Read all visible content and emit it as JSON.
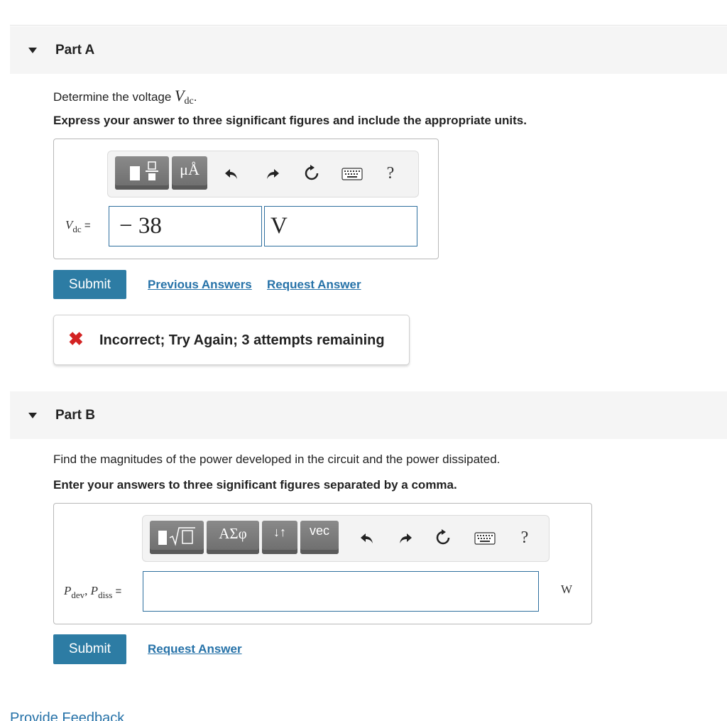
{
  "partA": {
    "title": "Part A",
    "prompt_text": "Determine the voltage ",
    "prompt_var": "V",
    "prompt_sub": "dc",
    "prompt_end": ".",
    "instruction": "Express your answer to three significant figures and include the appropriate units.",
    "toolbar": {
      "units_button_label": "μÅ",
      "help_label": "?"
    },
    "label_var": "V",
    "label_sub": "dc",
    "label_eq": " =",
    "value": "− 38",
    "unit": "V",
    "submit_label": "Submit",
    "previous_answers_label": "Previous Answers",
    "request_answer_label": "Request Answer",
    "feedback": {
      "icon": "x-icon",
      "message": "Incorrect; Try Again; 3 attempts remaining",
      "color": "#d32323"
    }
  },
  "partB": {
    "title": "Part B",
    "prompt": "Find the magnitudes of the power developed in the circuit and the power dissipated.",
    "instruction": "Enter your answers to three significant figures separated by a comma.",
    "toolbar": {
      "greek_button_label": "ΑΣφ",
      "arrows_button_label": "↓↑",
      "vec_button_label": "vec",
      "help_label": "?"
    },
    "label_var1": "P",
    "label_sub1": "dev",
    "label_sep": ", ",
    "label_var2": "P",
    "label_sub2": "diss",
    "label_eq": " =",
    "value": "",
    "unit": "W",
    "submit_label": "Submit",
    "request_answer_label": "Request Answer"
  },
  "footer": {
    "provide_feedback_label": "Provide Feedback"
  },
  "colors": {
    "accent": "#2d7ca4",
    "link": "#2672a8",
    "error": "#d32323"
  }
}
